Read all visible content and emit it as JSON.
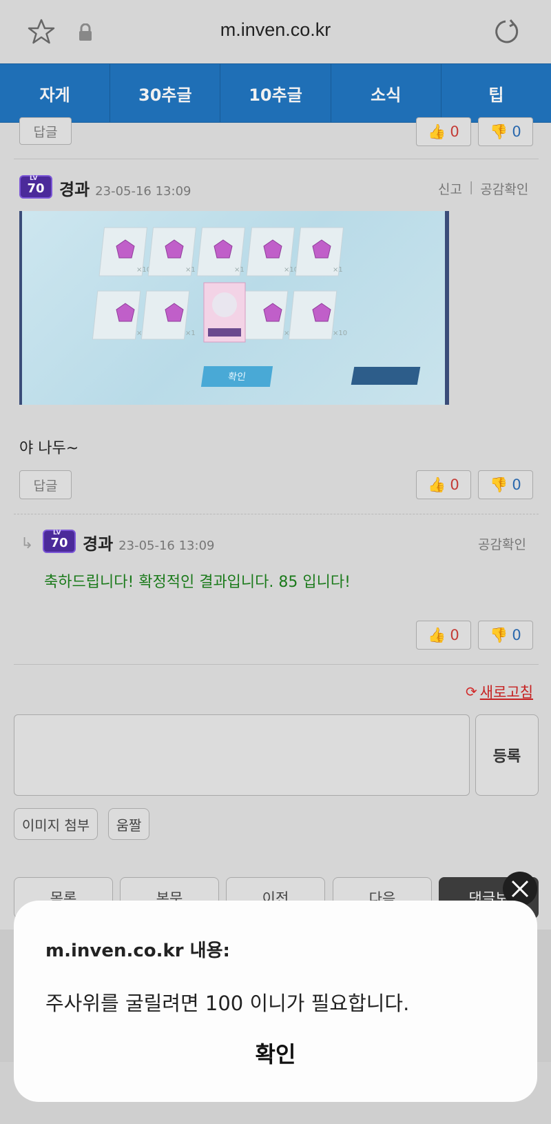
{
  "browser": {
    "url": "m.inven.co.kr",
    "icons": [
      "star-icon",
      "lock-icon",
      "reload-icon"
    ]
  },
  "tabs": [
    "자게",
    "30추글",
    "10추글",
    "소식",
    "팁"
  ],
  "top_partial": {
    "reply_label": "답글",
    "up_count": "0",
    "down_count": "0"
  },
  "comment1": {
    "level": "70",
    "nickname": "경과",
    "date": "23-05-16 13:09",
    "report_label": "신고",
    "like_label": "공감확인",
    "image_confirm": "확인",
    "image_counts": [
      "×10",
      "×1",
      "×1",
      "×10",
      "×1",
      "×1",
      "×1",
      "×1",
      "×10"
    ],
    "text": "야 나두~",
    "reply_label": "답글",
    "up_count": "0",
    "down_count": "0"
  },
  "comment2": {
    "level": "70",
    "nickname": "경과",
    "date": "23-05-16 13:09",
    "like_label": "공감확인",
    "text": "축하드립니다! 확정적인 결과입니다. 85 입니다!",
    "text_color": "#1b7a1b",
    "up_count": "0",
    "down_count": "0"
  },
  "refresh_label": "새로고침",
  "submit_label": "등록",
  "attach_image_label": "이미지 첨부",
  "gif_label": "움짤",
  "nav": [
    "목록",
    "본문",
    "이전",
    "다음",
    "댓글보"
  ],
  "dialog": {
    "title": "m.inven.co.kr 내용:",
    "message": "주사위를 굴릴려면 100 이니가 필요합니다.",
    "confirm": "확인"
  }
}
